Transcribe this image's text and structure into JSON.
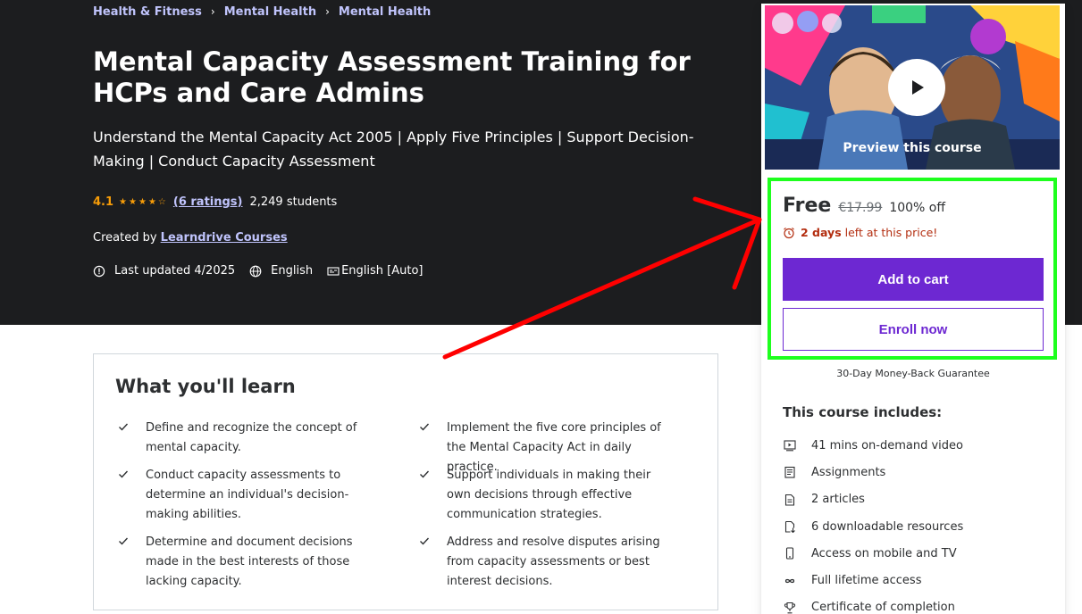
{
  "breadcrumbs": [
    "Health & Fitness",
    "Mental Health",
    "Mental Health"
  ],
  "course": {
    "title": "Mental Capacity Assessment Training for HCPs and Care Admins",
    "subtitle": "Understand the Mental Capacity Act 2005 | Apply Five Principles | Support Decision-Making | Conduct Capacity Assessment",
    "rating": "4.1",
    "ratings_link": "(6 ratings)",
    "students": "2,249 students",
    "created_by_label": "Created by",
    "author": "Learndrive Courses",
    "last_updated": "Last updated 4/2025",
    "language": "English",
    "captions": "English [Auto]"
  },
  "learn": {
    "title": "What you'll learn",
    "items": [
      "Define and recognize the concept of mental capacity.",
      "Implement the five core principles of the Mental Capacity Act in daily practice.",
      "Conduct capacity assessments to determine an individual's decision-making abilities.",
      "Support individuals in making their own decisions through effective communication strategies.",
      "Determine and document decisions made in the best interests of those lacking capacity.",
      "Address and resolve disputes arising from capacity assessments or best interest decisions."
    ]
  },
  "sidebar": {
    "preview_label": "Preview this course",
    "price": "Free",
    "original_price": "€17.99",
    "discount": "100% off",
    "timer_bold": "2 days",
    "timer_rest": "left at this price!",
    "add_to_cart": "Add to cart",
    "enroll_now": "Enroll now",
    "guarantee": "30-Day Money-Back Guarantee",
    "includes_title": "This course includes:",
    "includes": [
      {
        "icon": "video-icon",
        "label": "41 mins on-demand video"
      },
      {
        "icon": "assignment-icon",
        "label": "Assignments"
      },
      {
        "icon": "article-icon",
        "label": "2 articles"
      },
      {
        "icon": "download-icon",
        "label": "6 downloadable resources"
      },
      {
        "icon": "mobile-icon",
        "label": "Access on mobile and TV"
      },
      {
        "icon": "infinity-icon",
        "label": "Full lifetime access"
      },
      {
        "icon": "trophy-icon",
        "label": "Certificate of completion"
      }
    ]
  },
  "colors": {
    "hero_bg": "#1c1d1f",
    "link": "#c0c4fc",
    "star": "#f69c08",
    "brand_purple": "#6d28d2",
    "timer_red": "#b32d0f",
    "annotation_green": "#1eff1e",
    "annotation_red": "#ff0000"
  }
}
